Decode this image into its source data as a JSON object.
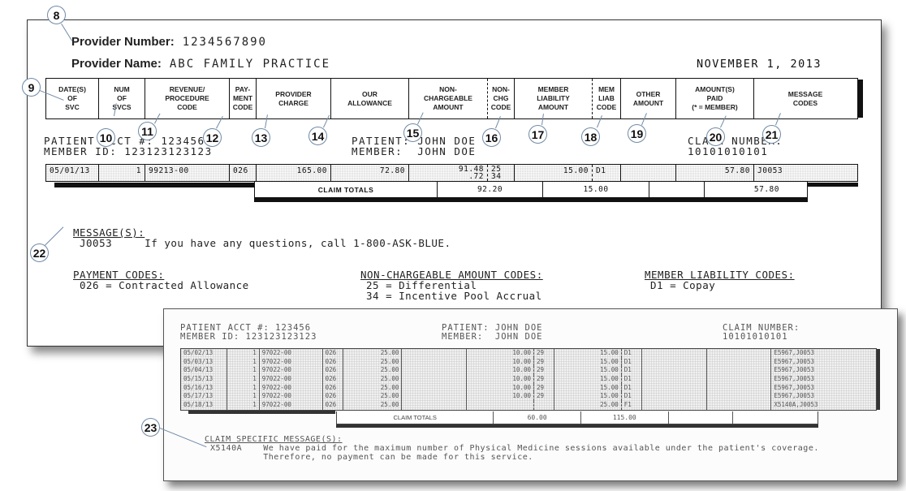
{
  "statement": {
    "provider_number_label": "Provider Number:",
    "provider_number": "1234567890",
    "provider_name_label": "Provider Name:",
    "provider_name": "ABC FAMILY PRACTICE",
    "date": "NOVEMBER 1, 2013",
    "columns": [
      "DATE(S)\nOF\nSVC",
      "NUM\nOF\nSVCS",
      "REVENUE/\nPROCEDURE\nCODE",
      "PAY-\nMENT\nCODE",
      "PROVIDER\nCHARGE",
      "OUR\nALLOWANCE",
      "NON-\nCHARGEABLE\nAMOUNT",
      "NON-\nCHG\nCODE",
      "MEMBER\nLIABILITY\nAMOUNT",
      "MEM\nLIAB\nCODE",
      "OTHER\nAMOUNT",
      "AMOUNT(S)\nPAID\n(* = MEMBER)",
      "MESSAGE\nCODES"
    ],
    "patient_acct_line": "PATIENT ACCT #: 123456",
    "member_id_line": "MEMBER ID: 123123123123",
    "patient_line": "PATIENT: JOHN DOE",
    "member_line": "MEMBER:  JOHN DOE",
    "claim_number_label": "CLAIM NUMBER:",
    "claim_number": "10101010101",
    "service_row": {
      "date": "05/01/13",
      "num": "1",
      "procedure": "99213-00",
      "payment_code": "026",
      "provider_charge": "165.00",
      "our_allowance": "72.80",
      "non_chargeable": "91.48\n  .72",
      "non_chg_code": "25\n34",
      "member_liability": "15.00",
      "mem_liab_code": "D1",
      "other_amount": "",
      "amount_paid": "57.80",
      "message_codes": "J0053"
    },
    "totals": {
      "label": "CLAIM TOTALS",
      "non_chargeable": "92.20",
      "member_liability": "15.00",
      "other_amount": "",
      "amount_paid": "57.80"
    },
    "messages_title": "MESSAGE(S):",
    "messages": [
      {
        "code": "J0053",
        "text": "If you have any questions, call 1-800-ASK-BLUE."
      }
    ],
    "payment_codes_title": "PAYMENT CODES:",
    "payment_codes": [
      "026 = Contracted Allowance"
    ],
    "non_chargeable_codes_title": "NON-CHARGEABLE AMOUNT CODES:",
    "non_chargeable_codes": [
      "25 = Differential",
      "34 = Incentive Pool Accrual"
    ],
    "member_liability_codes_title": "MEMBER LIABILITY CODES:",
    "member_liability_codes": [
      "D1 = Copay"
    ]
  },
  "callouts": [
    "8",
    "9",
    "10",
    "11",
    "12",
    "13",
    "14",
    "15",
    "16",
    "17",
    "18",
    "19",
    "20",
    "21",
    "22",
    "23"
  ],
  "claim_example": {
    "patient_acct_line": "PATIENT ACCT #: 123456",
    "member_id_line": "MEMBER ID: 123123123123",
    "patient_line": "PATIENT: JOHN DOE",
    "member_line": "MEMBER:  JOHN DOE",
    "claim_number_label": "CLAIM NUMBER:",
    "claim_number": "10101010101",
    "rows": [
      {
        "date": "05/02/13",
        "num": "1",
        "procedure": "97022-00",
        "pay": "026",
        "charge": "25.00",
        "allow": "",
        "nonchg": "10.00",
        "nonchg_code": "29",
        "mem_liab": "15.00",
        "mem_code": "D1",
        "other": "",
        "paid": "",
        "msgs": "E5967,J0053"
      },
      {
        "date": "05/03/13",
        "num": "1",
        "procedure": "97022-00",
        "pay": "026",
        "charge": "25.00",
        "allow": "",
        "nonchg": "10.00",
        "nonchg_code": "29",
        "mem_liab": "15.00",
        "mem_code": "D1",
        "other": "",
        "paid": "",
        "msgs": "E5967,J0053"
      },
      {
        "date": "05/04/13",
        "num": "1",
        "procedure": "97022-00",
        "pay": "026",
        "charge": "25.00",
        "allow": "",
        "nonchg": "10.00",
        "nonchg_code": "29",
        "mem_liab": "15.00",
        "mem_code": "D1",
        "other": "",
        "paid": "",
        "msgs": "E5967,J0053"
      },
      {
        "date": "05/15/13",
        "num": "1",
        "procedure": "97022-00",
        "pay": "026",
        "charge": "25.00",
        "allow": "",
        "nonchg": "10.00",
        "nonchg_code": "29",
        "mem_liab": "15.00",
        "mem_code": "D1",
        "other": "",
        "paid": "",
        "msgs": "E5967,J0053"
      },
      {
        "date": "05/16/13",
        "num": "1",
        "procedure": "97022-00",
        "pay": "026",
        "charge": "25.00",
        "allow": "",
        "nonchg": "10.00",
        "nonchg_code": "29",
        "mem_liab": "15.00",
        "mem_code": "D1",
        "other": "",
        "paid": "",
        "msgs": "E5967,J0053"
      },
      {
        "date": "05/17/13",
        "num": "1",
        "procedure": "97022-00",
        "pay": "026",
        "charge": "25.00",
        "allow": "",
        "nonchg": "10.00",
        "nonchg_code": "29",
        "mem_liab": "15.00",
        "mem_code": "D1",
        "other": "",
        "paid": "",
        "msgs": "E5967,J0053"
      },
      {
        "date": "05/18/13",
        "num": "1",
        "procedure": "97022-00",
        "pay": "026",
        "charge": "25.00",
        "allow": "",
        "nonchg": "",
        "nonchg_code": "",
        "mem_liab": "25.00",
        "mem_code": "F1",
        "other": "",
        "paid": "",
        "msgs": "X5140A,J0053"
      }
    ],
    "totals": {
      "label": "CLAIM TOTALS",
      "nonchg": "60.00",
      "mem_liab": "115.00"
    },
    "messages_title": "CLAIM SPECIFIC MESSAGE(S):",
    "messages": [
      {
        "code": "X5140A",
        "text": "We have paid for the maximum number of Physical Medicine sessions available under the patient's coverage.\n          Therefore, no payment can be made for this service."
      }
    ]
  }
}
